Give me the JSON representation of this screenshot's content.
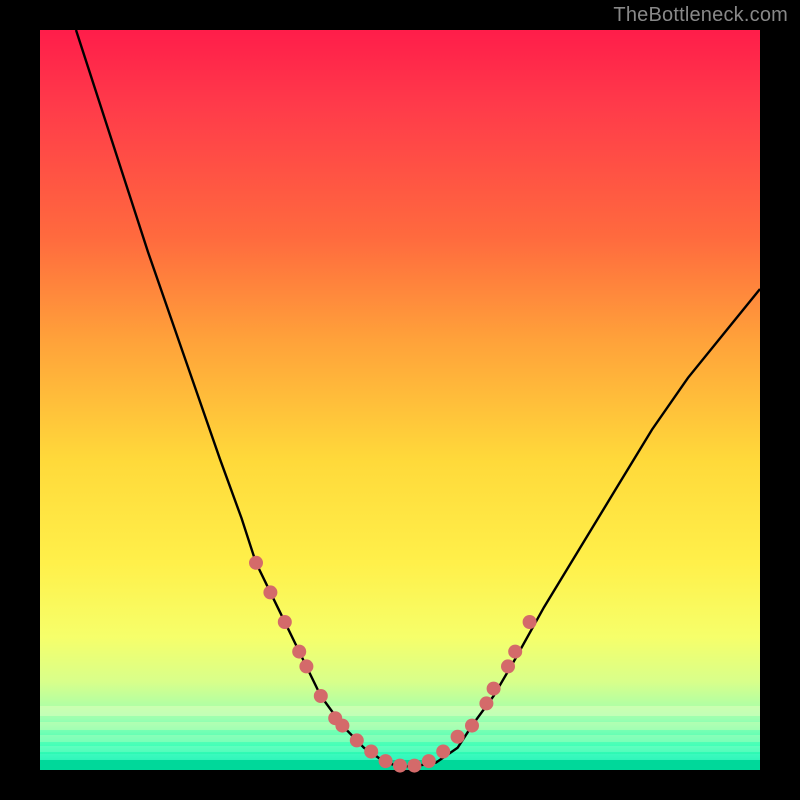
{
  "watermark": "TheBottleneck.com",
  "colors": {
    "background": "#000000",
    "curve": "#000000",
    "marker": "#d46a6a",
    "gradient_top": "#ff1d4a",
    "gradient_mid": "#ffe84a",
    "gradient_bottom": "#00e6a8"
  },
  "chart_data": {
    "type": "line",
    "title": "",
    "xlabel": "",
    "ylabel": "",
    "xlim": [
      0,
      100
    ],
    "ylim": [
      0,
      100
    ],
    "series": [
      {
        "name": "bottleneck-curve",
        "x": [
          5,
          10,
          15,
          20,
          25,
          28,
          30,
          33,
          36,
          39,
          42,
          45,
          48,
          50,
          52,
          55,
          58,
          60,
          63,
          66,
          70,
          75,
          80,
          85,
          90,
          95,
          100
        ],
        "y": [
          100,
          85,
          70,
          56,
          42,
          34,
          28,
          22,
          16,
          10,
          6,
          3,
          1,
          0.5,
          0.5,
          1,
          3,
          6,
          10,
          15,
          22,
          30,
          38,
          46,
          53,
          59,
          65
        ]
      }
    ],
    "markers": {
      "name": "highlight-points",
      "x": [
        30,
        32,
        34,
        36,
        37,
        39,
        41,
        42,
        44,
        46,
        48,
        50,
        52,
        54,
        56,
        58,
        60,
        62,
        63,
        65,
        66,
        68
      ],
      "y": [
        28,
        24,
        20,
        16,
        14,
        10,
        7,
        6,
        4,
        2.5,
        1.2,
        0.6,
        0.6,
        1.2,
        2.5,
        4.5,
        6,
        9,
        11,
        14,
        16,
        20
      ]
    }
  }
}
